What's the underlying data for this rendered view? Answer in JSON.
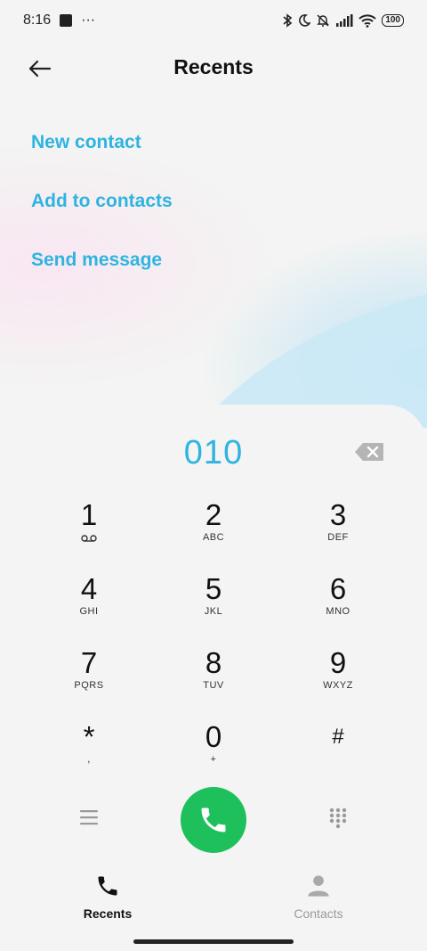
{
  "status_bar": {
    "time": "8:16",
    "more": "···",
    "battery": "100",
    "icons": [
      "bluetooth-icon",
      "moon-icon",
      "mute-bell-icon",
      "signal-icon",
      "wifi-icon",
      "battery-icon"
    ]
  },
  "header": {
    "title": "Recents",
    "back_icon": "arrow-left-icon"
  },
  "actions": {
    "new_contact": "New contact",
    "add_to_contacts": "Add to contacts",
    "send_message": "Send message"
  },
  "dialer": {
    "number": "010",
    "backspace_icon": "backspace-icon",
    "keys": [
      {
        "digit": "1",
        "letters": ""
      },
      {
        "digit": "2",
        "letters": "ABC"
      },
      {
        "digit": "3",
        "letters": "DEF"
      },
      {
        "digit": "4",
        "letters": "GHI"
      },
      {
        "digit": "5",
        "letters": "JKL"
      },
      {
        "digit": "6",
        "letters": "MNO"
      },
      {
        "digit": "7",
        "letters": "PQRS"
      },
      {
        "digit": "8",
        "letters": "TUV"
      },
      {
        "digit": "9",
        "letters": "WXYZ"
      },
      {
        "digit": "*",
        "letters": ","
      },
      {
        "digit": "0",
        "letters": "+"
      },
      {
        "digit": "#",
        "letters": ""
      }
    ]
  },
  "bottom_nav": {
    "recents": "Recents",
    "contacts": "Contacts"
  },
  "colors": {
    "accent": "#2eb4e0",
    "call": "#1ec05c",
    "background": "#f3f4f3"
  }
}
